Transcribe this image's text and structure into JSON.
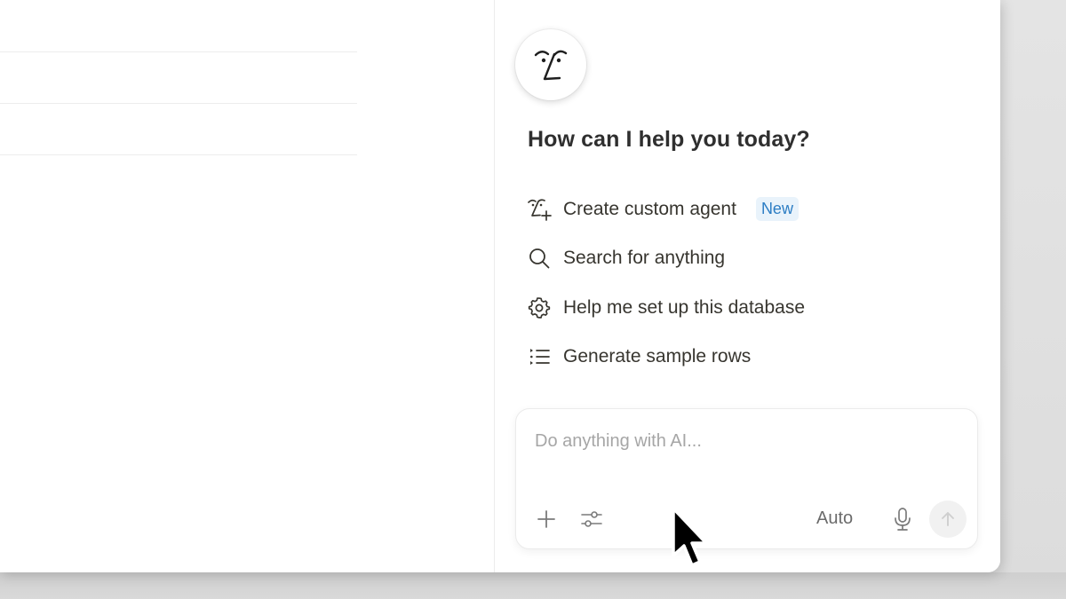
{
  "ai_panel": {
    "greeting": "How can I help you today?",
    "suggestions": [
      {
        "label": "Create custom agent",
        "icon": "agent-plus-icon",
        "badge": "New"
      },
      {
        "label": "Search for anything",
        "icon": "search-icon"
      },
      {
        "label": "Help me set up this database",
        "icon": "gear-icon"
      },
      {
        "label": "Generate sample rows",
        "icon": "list-icon"
      }
    ],
    "composer": {
      "placeholder": "Do anything with AI...",
      "value": "",
      "model_label": "Auto"
    }
  },
  "colors": {
    "badge_bg": "#e9f3fb",
    "badge_text": "#2b7dc4",
    "text": "#37352f",
    "placeholder": "#a6a6a6"
  }
}
